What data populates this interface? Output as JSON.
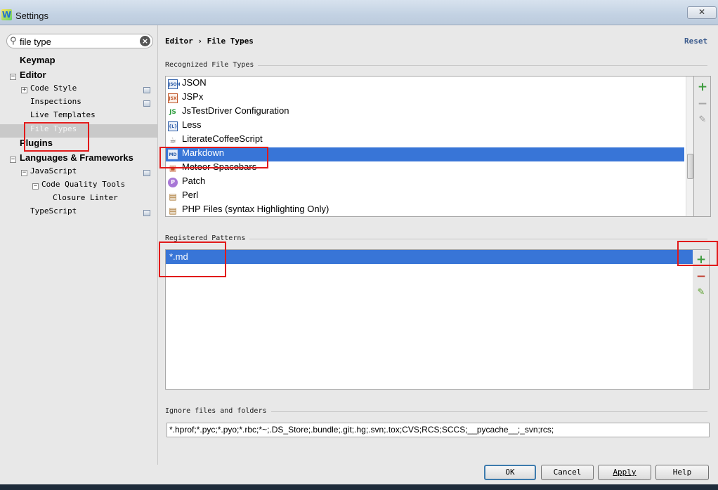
{
  "window": {
    "title": "Settings",
    "close_label": "✕"
  },
  "search": {
    "value": "file type",
    "clear_label": "×",
    "icon": "search-icon"
  },
  "tree": {
    "keymap": "Keymap",
    "editor": "Editor",
    "code_style": "Code Style",
    "inspections": "Inspections",
    "live_templates": "Live Templates",
    "file_types": "File Types",
    "plugins": "Plugins",
    "languages": "Languages & Frameworks",
    "javascript": "JavaScript",
    "code_quality": "Code Quality Tools",
    "closure_linter": "Closure Linter",
    "typescript": "TypeScript",
    "expand": "+",
    "collapse": "−"
  },
  "panel": {
    "breadcrumb": "Editor › File Types",
    "reset": "Reset",
    "recognized_label": "Recognized File Types",
    "patterns_label": "Registered Patterns",
    "ignore_label": "Ignore files and folders",
    "ignore_value": "*.hprof;*.pyc;*.pyo;*.rbc;*~;.DS_Store;.bundle;.git;.hg;.svn;.tox;CVS;RCS;SCCS;__pycache__;_svn;rcs;"
  },
  "file_types": [
    {
      "label": "JSON",
      "icon": "json-icon",
      "glyph": "JSON",
      "color": "#2d5da8"
    },
    {
      "label": "JSPx",
      "icon": "jspx-icon",
      "glyph": "JSX",
      "color": "#c0572a"
    },
    {
      "label": "JsTestDriver Configuration",
      "icon": "jstestdriver-icon",
      "glyph": "JS",
      "color": "#2f9e3f"
    },
    {
      "label": "Less",
      "icon": "less-icon",
      "glyph": "{L}",
      "color": "#2d5da8"
    },
    {
      "label": "LiterateCoffeeScript",
      "icon": "coffeescript-icon",
      "glyph": "☕",
      "color": "#555555"
    },
    {
      "label": "Markdown",
      "icon": "markdown-icon",
      "glyph": "MD",
      "color": "#2d5da8",
      "selected": true
    },
    {
      "label": "Meteor Spacebars",
      "icon": "meteor-icon",
      "glyph": "▣",
      "color": "#c0572a"
    },
    {
      "label": "Patch",
      "icon": "patch-icon",
      "glyph": "P",
      "color": "#8e4fc1"
    },
    {
      "label": "Perl",
      "icon": "perl-icon",
      "glyph": "▤",
      "color": "#a06a1e"
    },
    {
      "label": "PHP Files (syntax Highlighting Only)",
      "icon": "php-icon",
      "glyph": "▤",
      "color": "#a06a1e"
    }
  ],
  "patterns": [
    {
      "label": "*.md"
    }
  ],
  "tools": {
    "plus": "+",
    "minus": "−",
    "edit": "✎"
  },
  "buttons": {
    "ok": "OK",
    "cancel": "Cancel",
    "apply": "Apply",
    "help": "Help"
  },
  "colors": {
    "selection": "#3875d7",
    "annotation": "#e11a1a",
    "add": "#3e9b3e",
    "remove": "#c0392b"
  }
}
